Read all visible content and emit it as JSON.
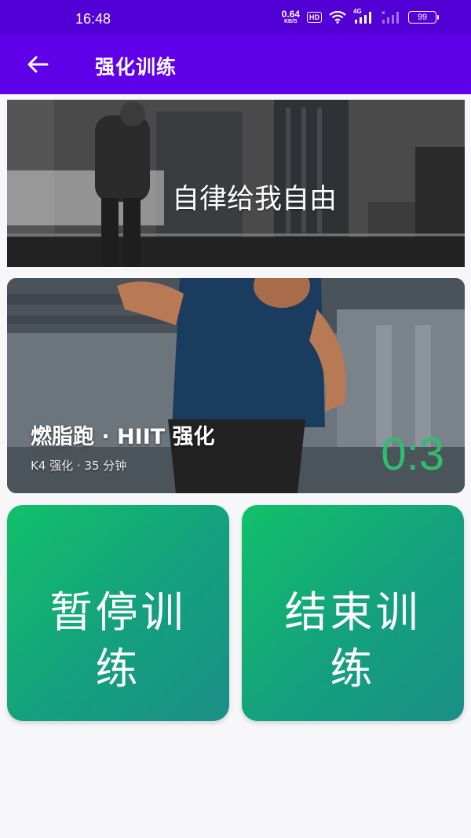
{
  "status_bar": {
    "time": "16:48",
    "net_speed": "0.64",
    "net_speed_unit": "KB/S",
    "hd_badge": "HD",
    "signal_label": "4G",
    "battery": "99"
  },
  "app_bar": {
    "back_icon": "arrow-left-icon",
    "title": "强化训练"
  },
  "banner": {
    "slogan": "自律给我自由"
  },
  "course": {
    "title": "燃脂跑 · HIIT 强化",
    "subtitle": "K4 强化 · 35 分钟",
    "timer": "0:3"
  },
  "actions": {
    "pause_label": "暂停训练",
    "end_label": "结束训练"
  },
  "colors": {
    "status_bar": "#5200d6",
    "app_bar": "#5f00e8",
    "button_gradient_start": "#12c06a",
    "button_gradient_end": "#1a8f87",
    "timer": "#2dbf6d"
  }
}
